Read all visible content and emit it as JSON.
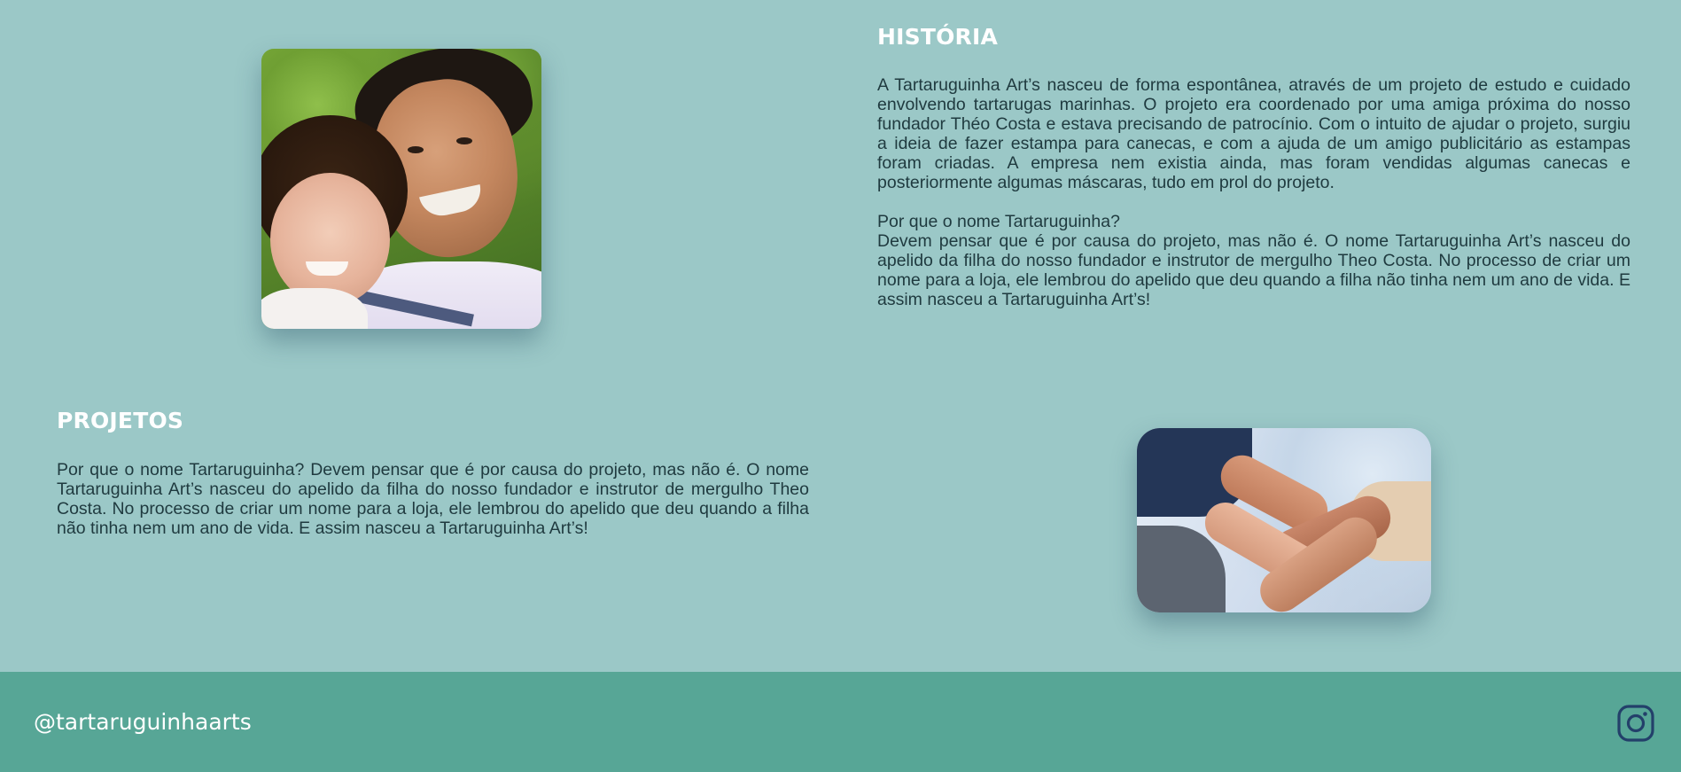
{
  "historia": {
    "title": "HISTÓRIA",
    "paragraph1": "A Tartaruguinha Art’s nasceu de forma espontânea, através de um projeto de estudo e cuidado envolvendo tartarugas marinhas. O projeto era coordenado por uma amiga próxima do nosso fundador Théo Costa e estava precisando de patrocínio. Com o intuito de ajudar o projeto, surgiu a ideia de fazer estampa para canecas, e com a ajuda de um amigo publicitário as estampas foram criadas. A empresa nem existia ainda, mas foram vendidas algumas canecas e posteriormente algumas máscaras, tudo em prol do projeto.",
    "question": "Por que o nome Tartaruguinha?",
    "paragraph2": "Devem pensar que é por causa do projeto, mas não é. O nome Tartaruguinha Art’s nasceu do apelido da filha do nosso fundador e instrutor de mergulho Theo Costa. No processo de criar um nome para a loja, ele lembrou do apelido que deu quando a filha não tinha nem um ano de vida. E assim nasceu a Tartaruguinha Art’s!"
  },
  "projetos": {
    "title": "PROJETOS",
    "paragraph": "Por que o nome Tartaruguinha? Devem pensar que é por causa do projeto, mas não é. O nome Tartaruguinha Art’s nasceu do apelido da filha do nosso fundador e instrutor de mergulho Theo Costa. No processo de criar um nome para a loja, ele lembrou do apelido que deu quando a filha não tinha nem um ano de vida. E assim nasceu a Tartaruguinha Art’s!"
  },
  "footer": {
    "handle": "@tartaruguinhaarts",
    "icon": "instagram-icon"
  },
  "colors": {
    "page_background": "#9bc8c7",
    "footer_background": "#57a696",
    "heading": "#ffffff",
    "body_text": "#1f3a3f",
    "instagram_icon": "#23406a"
  }
}
